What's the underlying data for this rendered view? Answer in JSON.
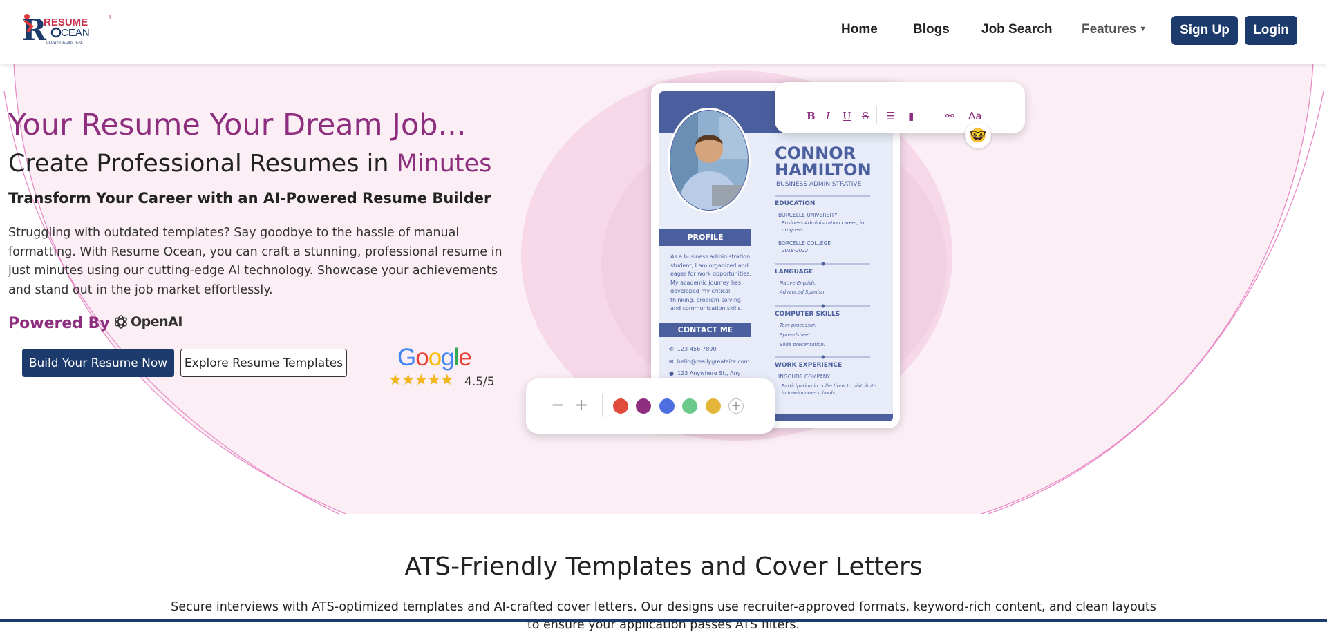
{
  "brand": {
    "line1": "RESUME",
    "line2": "OCEAN",
    "tagline": "GROWTH BEGINS HERE",
    "registered": "®"
  },
  "nav": {
    "items": [
      {
        "label": "Home"
      },
      {
        "label": "Blogs"
      },
      {
        "label": "Job Search"
      },
      {
        "label": "Features"
      }
    ],
    "signup": "Sign Up",
    "login": "Login"
  },
  "hero": {
    "title": "Your Resume Your Dream Job...",
    "subtitle_prefix": "Create Professional Resumes in ",
    "subtitle_accent": "Minutes",
    "tagline": "Transform Your Career with an AI-Powered Resume Builder",
    "description": "Struggling with outdated templates? Say goodbye to the hassle of manual formatting. With Resume Ocean, you can craft a stunning, professional resume in just minutes using our cutting-edge AI technology. Showcase your achievements and stand out in the job market effortlessly.",
    "powered_by": "Powered By",
    "openai": "OpenAI",
    "build_btn": "Build Your Resume Now",
    "explore_btn": "Explore Resume Templates",
    "google": "Google",
    "stars": "★★★★★",
    "rating": "4.5/5"
  },
  "resume": {
    "first_name": "CONNOR",
    "last_name": "HAMILTON",
    "role": "BUSINESS ADMINISTRATIVE",
    "profile_heading": "PROFILE",
    "profile_text": "As a business administration student, I am organized and eager for work opportunities. My academic journey has developed my critical thinking, problem-solving, and communication skills.",
    "contact_heading": "CONTACT ME",
    "phone": "123-456-7890",
    "email": "hello@reallygreatsite.com",
    "address": "123 Anywhere St., Any",
    "education_heading": "EDUCATION",
    "edu1_school": "BORCELLE UNIVERSITY",
    "edu1_detail": "Business Administration career, in progress.",
    "edu2_school": "BORCELLE COLLEGE",
    "edu2_detail": "2018-2022",
    "language_heading": "LANGUAGE",
    "lang1": "Native English.",
    "lang2": "Advanced Spanish.",
    "skills_heading": "COMPUTER SKILLS",
    "skill1": "Text processor.",
    "skill2": "Spreadsheet.",
    "skill3": "Slide presentation.",
    "work_heading": "WORK EXPERIENCE",
    "work_company": "INGOUDE COMPANY",
    "work_detail": "Participation in collections to distribute in low-income schools."
  },
  "toolbar": {
    "bold": "B",
    "italic": "I",
    "underline": "U",
    "strike": "S",
    "font": "Aa"
  },
  "colors": {
    "accent": "#8e2e7e",
    "navy": "#1c3a6b",
    "swatches": [
      "#e04b3c",
      "#8e2e7e",
      "#4e6fe0",
      "#6cc98c",
      "#e3b63a"
    ]
  },
  "section": {
    "title": "ATS-Friendly Templates and Cover Letters",
    "description": "Secure interviews with ATS-optimized templates and AI-crafted cover letters. Our designs use recruiter-approved formats, keyword-rich content, and clean layouts to ensure your application passes ATS filters."
  }
}
